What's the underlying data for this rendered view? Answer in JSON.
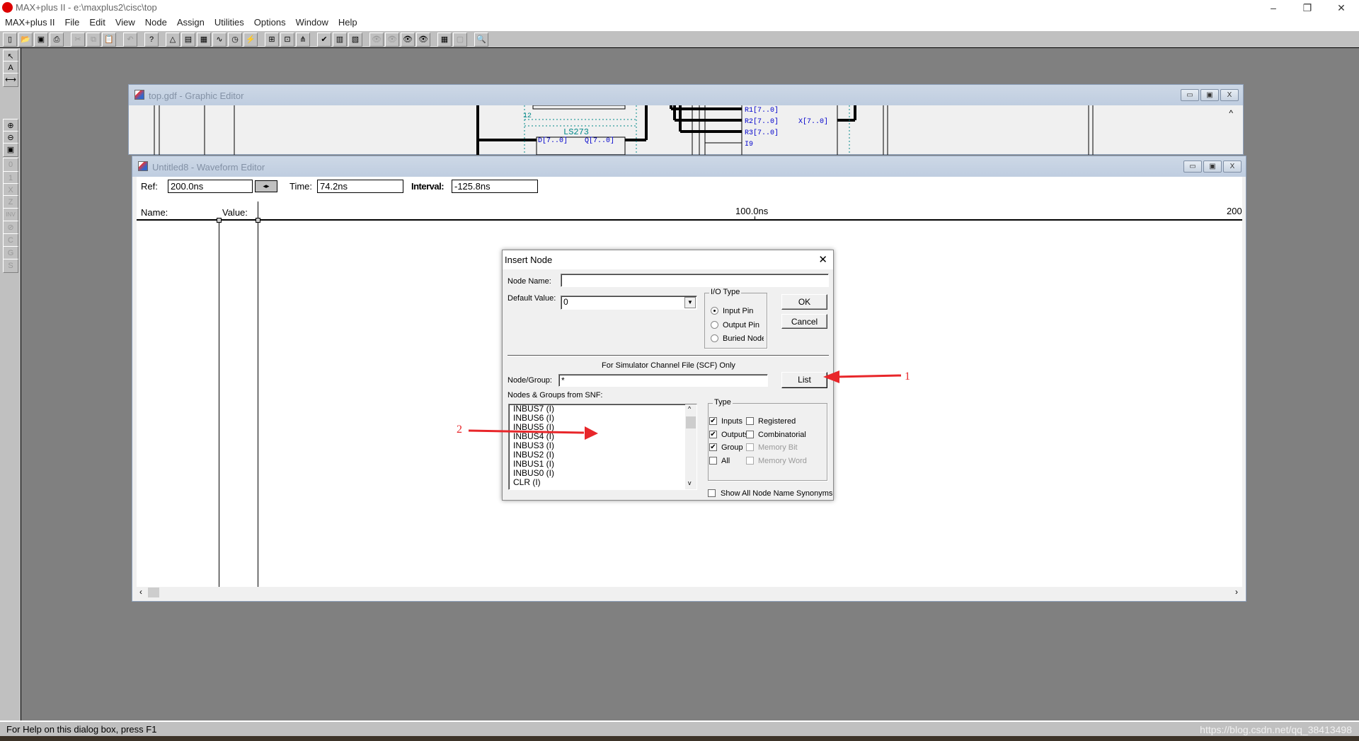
{
  "app": {
    "title": "MAX+plus II - e:\\maxplus2\\cisc\\top",
    "window_controls": [
      "–",
      "❐",
      "✕"
    ]
  },
  "menu": [
    "MAX+plus II",
    "File",
    "Edit",
    "View",
    "Node",
    "Assign",
    "Utilities",
    "Options",
    "Window",
    "Help"
  ],
  "toolbar": [
    {
      "icon": "new-file-icon",
      "g": "▯"
    },
    {
      "icon": "open-folder-icon",
      "g": "📂"
    },
    {
      "icon": "save-icon",
      "g": "▣"
    },
    {
      "icon": "print-icon",
      "g": "⎙"
    },
    {
      "sep": true
    },
    {
      "icon": "cut-icon",
      "g": "✂",
      "dis": true
    },
    {
      "icon": "copy-icon",
      "g": "⧉",
      "dis": true
    },
    {
      "icon": "paste-icon",
      "g": "📋",
      "dis": true
    },
    {
      "sep": true
    },
    {
      "icon": "undo-icon",
      "g": "↶",
      "dis": true
    },
    {
      "sep": true
    },
    {
      "icon": "help-pointer-icon",
      "g": "?"
    },
    {
      "sep": true
    },
    {
      "icon": "hierarchy-display-icon",
      "g": "△"
    },
    {
      "icon": "floorplan-editor-icon",
      "g": "▤"
    },
    {
      "icon": "compiler-icon",
      "g": "▦"
    },
    {
      "icon": "simulator-icon",
      "g": "∿"
    },
    {
      "icon": "timing-analyzer-icon",
      "g": "◷"
    },
    {
      "icon": "programmer-icon",
      "g": "⚡"
    },
    {
      "sep": true
    },
    {
      "icon": "project-set-icon",
      "g": "⊞"
    },
    {
      "icon": "project-top-icon",
      "g": "⊡"
    },
    {
      "icon": "hierarchy-up-icon",
      "g": "⋔"
    },
    {
      "sep": true
    },
    {
      "icon": "save-check-icon",
      "g": "✔"
    },
    {
      "icon": "save-compile-icon",
      "g": "▥"
    },
    {
      "icon": "save-simulate-icon",
      "g": "▧"
    },
    {
      "sep": true
    },
    {
      "icon": "find-text-icon",
      "g": "👁",
      "dis": true
    },
    {
      "icon": "replace-icon",
      "g": "👁",
      "dis": true
    },
    {
      "icon": "find-node-icon",
      "g": "👁"
    },
    {
      "icon": "find-clique-icon",
      "g": "👁"
    },
    {
      "sep": true
    },
    {
      "icon": "tile-icon",
      "g": "▦"
    },
    {
      "icon": "cascade-icon",
      "g": "▢",
      "dis": true
    },
    {
      "sep": true
    },
    {
      "icon": "zoom-find-icon",
      "g": "🔍",
      "dis": true
    }
  ],
  "left_toolbar": [
    {
      "icon": "selection-tool-icon",
      "g": "↖"
    },
    {
      "icon": "text-tool-icon",
      "g": "A"
    },
    {
      "icon": "join-tool-icon",
      "g": "⟷"
    },
    {
      "icon": "zoom-in-icon",
      "g": "⊕"
    },
    {
      "icon": "zoom-out-icon",
      "g": "⊖"
    },
    {
      "icon": "fit-in-window-icon",
      "g": "▣"
    },
    {
      "icon": "set-low-icon",
      "g": "0"
    },
    {
      "icon": "set-high-icon",
      "g": "1"
    },
    {
      "icon": "dont-care-icon",
      "g": "X"
    },
    {
      "icon": "high-impedance-icon",
      "g": "Z"
    },
    {
      "icon": "invert-icon",
      "g": "INV"
    },
    {
      "icon": "overwrite-clock-icon",
      "g": "⊘"
    },
    {
      "icon": "overwrite-count-icon",
      "g": "C"
    },
    {
      "icon": "overwrite-group-icon",
      "g": "G"
    },
    {
      "icon": "overwrite-state-icon",
      "g": "S"
    }
  ],
  "graphic_editor": {
    "title": "top.gdf - Graphic Editor",
    "labels": [
      "12",
      "LS273",
      "D[7..0]",
      "Q[7..0]",
      "R1[7..0]",
      "R2[7..0]",
      "R3[7..0]",
      "X[7..0]",
      "I9"
    ]
  },
  "waveform_editor": {
    "title": "Untitled8 - Waveform Editor",
    "ref_label": "Ref:",
    "ref_value": "200.0ns",
    "time_label": "Time:",
    "time_value": "74.2ns",
    "interval_label": "Interval:",
    "interval_value": "-125.8ns",
    "name_header": "Name:",
    "value_header": "Value:",
    "ticks": [
      "100.0ns",
      "200"
    ]
  },
  "dialog": {
    "title": "Insert Node",
    "node_name_label": "Node Name:",
    "node_name_value": "",
    "default_value_label": "Default Value:",
    "default_value": "0",
    "io_type_label": "I/O Type",
    "io_types": [
      {
        "label": "Input Pin",
        "selected": true
      },
      {
        "label": "Output Pin",
        "selected": false
      },
      {
        "label": "Buried Node",
        "selected": false
      }
    ],
    "ok": "OK",
    "cancel": "Cancel",
    "scf_label": "For Simulator Channel File (SCF) Only",
    "node_group_label": "Node/Group:",
    "node_group_value": "*",
    "list_button": "List",
    "nodes_label": "Nodes & Groups from SNF:",
    "nodes": [
      "INBUS7 (I)",
      "INBUS6 (I)",
      "INBUS5 (I)",
      "INBUS4 (I)",
      "INBUS3 (I)",
      "INBUS2 (I)",
      "INBUS1 (I)",
      "INBUS0 (I)",
      "CLR (I)"
    ],
    "type_label": "Type",
    "types": [
      {
        "label": "Inputs",
        "checked": true,
        "enabled": true
      },
      {
        "label": "Registered",
        "checked": false,
        "enabled": true
      },
      {
        "label": "Outputs",
        "checked": true,
        "enabled": true
      },
      {
        "label": "Combinatorial",
        "checked": false,
        "enabled": true
      },
      {
        "label": "Group",
        "checked": true,
        "enabled": true
      },
      {
        "label": "Memory Bit",
        "checked": false,
        "enabled": false
      },
      {
        "label": "All",
        "checked": false,
        "enabled": true
      },
      {
        "label": "Memory Word",
        "checked": false,
        "enabled": false
      }
    ],
    "show_synonyms": {
      "label": "Show All Node Name Synonyms",
      "checked": false
    }
  },
  "annotations": {
    "label_1": "1",
    "label_2": "2",
    "color": "#e8262a"
  },
  "status": {
    "text": "For Help on this dialog box, press F1",
    "watermark": "https://blog.csdn.net/qq_38413498"
  }
}
